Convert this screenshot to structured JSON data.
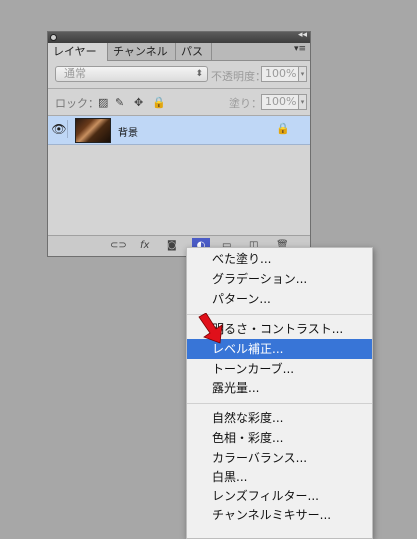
{
  "panel": {
    "tabs": [
      "レイヤー",
      "チャンネル",
      "パス"
    ],
    "blend_mode": "通常",
    "opacity_label": "不透明度：",
    "opacity_value": "100%",
    "lock_label": "ロック：",
    "fill_label": "塗り：",
    "fill_value": "100%",
    "layer": {
      "name": "背景",
      "locked": true,
      "visible": true
    },
    "bottom_icons": [
      "link-icon",
      "fx-icon",
      "mask-icon",
      "adjustment-icon",
      "group-folder-icon",
      "new-layer-icon",
      "trash-icon"
    ]
  },
  "menu": {
    "group1": [
      "べた塗り...",
      "グラデーション...",
      "パターン..."
    ],
    "group2": [
      "明るさ・コントラスト...",
      "レベル補正...",
      "トーンカーブ...",
      "露光量..."
    ],
    "group3": [
      "自然な彩度...",
      "色相・彩度...",
      "カラーバランス...",
      "白黒...",
      "レンズフィルター...",
      "チャンネルミキサー..."
    ],
    "highlighted": "レベル補正..."
  },
  "colors": {
    "highlight": "#3875d7",
    "layer_selected": "#bfd7f6",
    "arrow": "#e0101a"
  }
}
